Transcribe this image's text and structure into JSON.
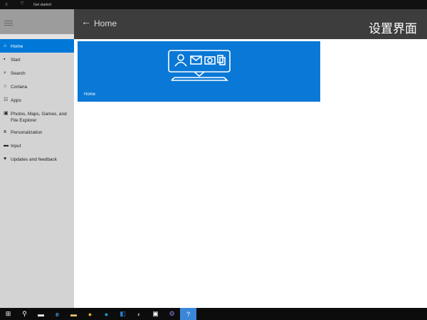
{
  "topbar": {
    "title": "Get started"
  },
  "header": {
    "title": "Home",
    "watermark": "设置界面"
  },
  "sidebar": {
    "items": [
      {
        "label": "Home",
        "icon": "home-icon",
        "selected": true
      },
      {
        "label": "Start",
        "icon": "start-icon"
      },
      {
        "label": "Search",
        "icon": "search-icon"
      },
      {
        "label": "Cortana",
        "icon": "cortana-icon"
      },
      {
        "label": "Apps",
        "icon": "apps-icon"
      },
      {
        "label": "Photos, Maps, Games, and",
        "label2": "File Explorer",
        "icon": "photos-icon"
      },
      {
        "label": "Personalization",
        "icon": "person-icon"
      },
      {
        "label": "Input",
        "icon": "keyboard-icon"
      },
      {
        "label": "Updates and feedback",
        "icon": "feedback-icon"
      }
    ]
  },
  "tile": {
    "label": "Home"
  },
  "colors": {
    "accent": "#0078d7"
  }
}
